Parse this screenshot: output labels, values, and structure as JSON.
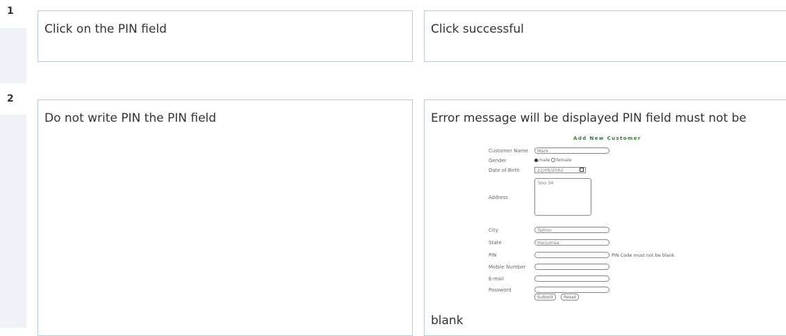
{
  "rows": [
    {
      "number": "1",
      "step": "Click on the PIN field",
      "expected": "Click successful"
    },
    {
      "number": "2",
      "step": "Do not write PIN the PIN field",
      "expected": "Error message will be displayed PIN field must not be",
      "expected_tail": "blank"
    }
  ],
  "form": {
    "title": "Add New Customer",
    "fields": {
      "customer_name": {
        "label": "Customer Name",
        "value": "Mark"
      },
      "gender": {
        "label": "Gender",
        "opt_male": "male",
        "opt_female": "female"
      },
      "dob": {
        "label": "Date of Birth",
        "value": "22/05/2002"
      },
      "address": {
        "label": "Address",
        "value": "Soo 34"
      },
      "city": {
        "label": "City",
        "value": "Tallinn"
      },
      "state": {
        "label": "State",
        "value": "Harjumaa"
      },
      "pin": {
        "label": "PIN",
        "value": "",
        "error": "PIN Code must not be blank"
      },
      "mobile": {
        "label": "Mobile Number",
        "value": ""
      },
      "email": {
        "label": "E-mail",
        "value": ""
      },
      "password": {
        "label": "Password",
        "value": ""
      }
    },
    "submit_label": "Submit",
    "reset_label": "Reset"
  },
  "colors": {
    "cell_border": "#b9c9dd",
    "row_strip": "#eef1f6",
    "form_title": "#2e7d32"
  }
}
